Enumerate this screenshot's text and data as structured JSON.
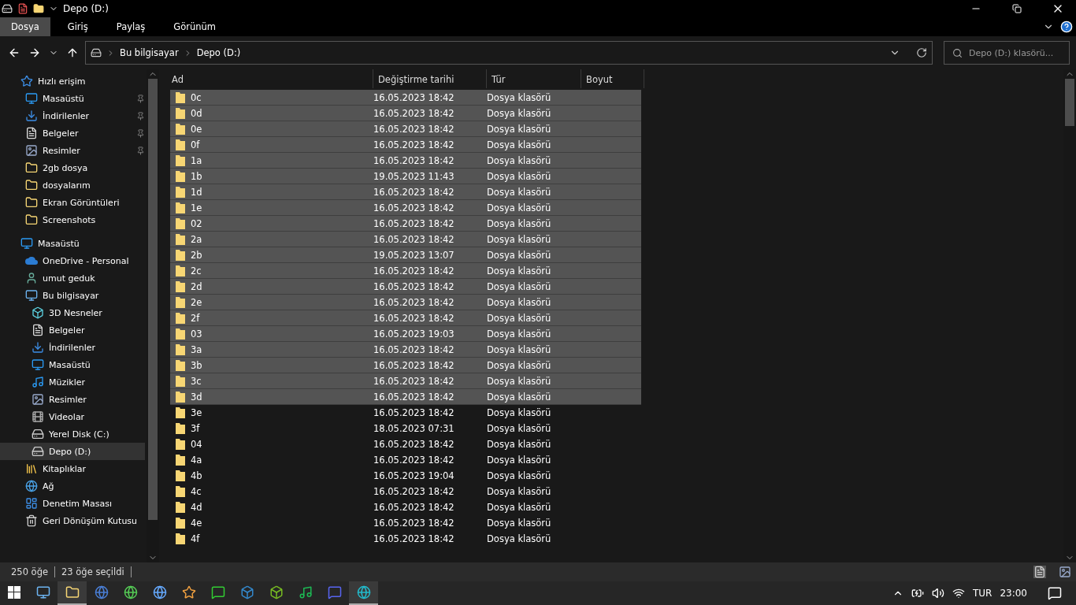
{
  "window": {
    "title": "Depo (D:)"
  },
  "ribbon_tabs": [
    {
      "label": "Dosya",
      "selected": true
    },
    {
      "label": "Giriş",
      "selected": false
    },
    {
      "label": "Paylaş",
      "selected": false
    },
    {
      "label": "Görünüm",
      "selected": false
    }
  ],
  "address": {
    "crumbs": [
      "Bu bilgisayar",
      "Depo (D:)"
    ]
  },
  "search": {
    "placeholder": "Depo (D:) klasörü..."
  },
  "sidebar": {
    "items": [
      {
        "label": "Hızlı erişim",
        "selected": false,
        "children": [
          {
            "label": "Masaüstü",
            "pinned": true,
            "selected": false
          },
          {
            "label": "İndirilenler",
            "pinned": true,
            "selected": false
          },
          {
            "label": "Belgeler",
            "pinned": true,
            "selected": false
          },
          {
            "label": "Resimler",
            "pinned": true,
            "selected": false
          },
          {
            "label": "2gb dosya",
            "pinned": false,
            "selected": false
          },
          {
            "label": "dosyalarım",
            "pinned": false,
            "selected": false
          },
          {
            "label": "Ekran Görüntüleri",
            "pinned": false,
            "selected": false
          },
          {
            "label": "Screenshots",
            "pinned": false,
            "selected": false
          }
        ]
      },
      {
        "label": "Masaüstü",
        "selected": false,
        "children": [
          {
            "label": "OneDrive - Personal",
            "selected": false
          },
          {
            "label": "umut geduk",
            "selected": false
          },
          {
            "label": "Bu bilgisayar",
            "selected": false,
            "children": [
              {
                "label": "3D Nesneler",
                "selected": false
              },
              {
                "label": "Belgeler",
                "selected": false
              },
              {
                "label": "İndirilenler",
                "selected": false
              },
              {
                "label": "Masaüstü",
                "selected": false
              },
              {
                "label": "Müzikler",
                "selected": false
              },
              {
                "label": "Resimler",
                "selected": false
              },
              {
                "label": "Videolar",
                "selected": false
              },
              {
                "label": "Yerel Disk (C:)",
                "selected": false
              },
              {
                "label": "Depo (D:)",
                "selected": true
              }
            ]
          },
          {
            "label": "Kitaplıklar",
            "selected": false
          },
          {
            "label": "Ağ",
            "selected": false
          },
          {
            "label": "Denetim Masası",
            "selected": false
          },
          {
            "label": "Geri Dönüşüm Kutusu",
            "selected": false
          }
        ]
      }
    ]
  },
  "table": {
    "columns": [
      "Ad",
      "Değiştirme tarihi",
      "Tür",
      "Boyut"
    ],
    "rows": [
      {
        "name": "0c",
        "date": "16.05.2023 18:42",
        "type": "Dosya klasörü",
        "selected": true
      },
      {
        "name": "0d",
        "date": "16.05.2023 18:42",
        "type": "Dosya klasörü",
        "selected": true
      },
      {
        "name": "0e",
        "date": "16.05.2023 18:42",
        "type": "Dosya klasörü",
        "selected": true
      },
      {
        "name": "0f",
        "date": "16.05.2023 18:42",
        "type": "Dosya klasörü",
        "selected": true
      },
      {
        "name": "1a",
        "date": "16.05.2023 18:42",
        "type": "Dosya klasörü",
        "selected": true
      },
      {
        "name": "1b",
        "date": "19.05.2023 11:43",
        "type": "Dosya klasörü",
        "selected": true
      },
      {
        "name": "1d",
        "date": "16.05.2023 18:42",
        "type": "Dosya klasörü",
        "selected": true
      },
      {
        "name": "1e",
        "date": "16.05.2023 18:42",
        "type": "Dosya klasörü",
        "selected": true
      },
      {
        "name": "02",
        "date": "16.05.2023 18:42",
        "type": "Dosya klasörü",
        "selected": true
      },
      {
        "name": "2a",
        "date": "16.05.2023 18:42",
        "type": "Dosya klasörü",
        "selected": true
      },
      {
        "name": "2b",
        "date": "19.05.2023 13:07",
        "type": "Dosya klasörü",
        "selected": true
      },
      {
        "name": "2c",
        "date": "16.05.2023 18:42",
        "type": "Dosya klasörü",
        "selected": true
      },
      {
        "name": "2d",
        "date": "16.05.2023 18:42",
        "type": "Dosya klasörü",
        "selected": true
      },
      {
        "name": "2e",
        "date": "16.05.2023 18:42",
        "type": "Dosya klasörü",
        "selected": true
      },
      {
        "name": "2f",
        "date": "16.05.2023 18:42",
        "type": "Dosya klasörü",
        "selected": true
      },
      {
        "name": "03",
        "date": "16.05.2023 19:03",
        "type": "Dosya klasörü",
        "selected": true
      },
      {
        "name": "3a",
        "date": "16.05.2023 18:42",
        "type": "Dosya klasörü",
        "selected": true
      },
      {
        "name": "3b",
        "date": "16.05.2023 18:42",
        "type": "Dosya klasörü",
        "selected": true
      },
      {
        "name": "3c",
        "date": "16.05.2023 18:42",
        "type": "Dosya klasörü",
        "selected": true
      },
      {
        "name": "3d",
        "date": "16.05.2023 18:42",
        "type": "Dosya klasörü",
        "selected": true
      },
      {
        "name": "3e",
        "date": "16.05.2023 18:42",
        "type": "Dosya klasörü",
        "selected": false
      },
      {
        "name": "3f",
        "date": "18.05.2023 07:31",
        "type": "Dosya klasörü",
        "selected": false
      },
      {
        "name": "04",
        "date": "16.05.2023 18:42",
        "type": "Dosya klasörü",
        "selected": false
      },
      {
        "name": "4a",
        "date": "16.05.2023 18:42",
        "type": "Dosya klasörü",
        "selected": false
      },
      {
        "name": "4b",
        "date": "16.05.2023 19:04",
        "type": "Dosya klasörü",
        "selected": false
      },
      {
        "name": "4c",
        "date": "16.05.2023 18:42",
        "type": "Dosya klasörü",
        "selected": false
      },
      {
        "name": "4d",
        "date": "16.05.2023 18:42",
        "type": "Dosya klasörü",
        "selected": false
      },
      {
        "name": "4e",
        "date": "16.05.2023 18:42",
        "type": "Dosya klasörü",
        "selected": false
      },
      {
        "name": "4f",
        "date": "16.05.2023 18:42",
        "type": "Dosya klasörü",
        "selected": false
      }
    ]
  },
  "status_bar": {
    "item_count": "250 öğe",
    "selected_count": "23 öğe seçildi"
  },
  "taskbar": {
    "language": "TUR",
    "time": "23:00"
  }
}
